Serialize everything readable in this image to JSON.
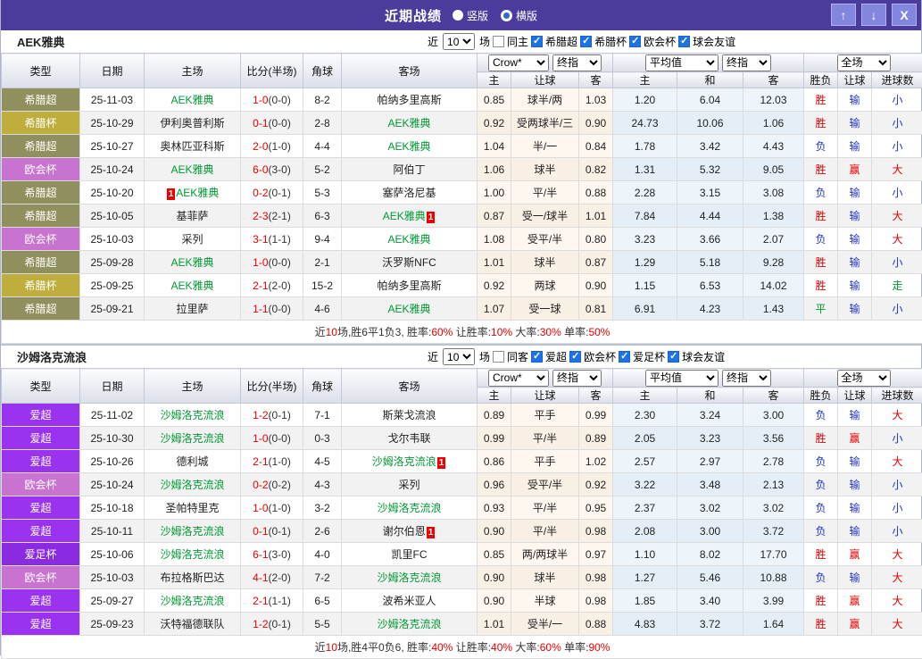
{
  "titlebar": {
    "title": "近期战绩",
    "radios": [
      {
        "label": "竖版",
        "selected": true
      },
      {
        "label": "横版",
        "selected": false
      }
    ],
    "buttons": {
      "up": "↑",
      "down": "↓",
      "close": "X"
    }
  },
  "filter_labels": {
    "near": "近",
    "matches_value": "10",
    "unit": "场"
  },
  "table_header": {
    "type": "类型",
    "date": "日期",
    "home": "主场",
    "score": "比分(半场)",
    "corner": "角球",
    "away": "客场",
    "group1_select1": "Crow*",
    "group1_select2": "终指",
    "group2_select1": "平均值",
    "group2_select2": "终指",
    "group3_select": "全场",
    "sub_odds_home": "主",
    "sub_handicap": "让球",
    "sub_odds_away": "客",
    "sub_avg_home": "主",
    "sub_avg_draw": "和",
    "sub_avg_away": "客",
    "sub_winloss": "胜负",
    "sub_res_handicap": "让球",
    "sub_goals": "进球数"
  },
  "type_colors": {
    "希腊超": "#90905e",
    "希腊杯": "#bfae3e",
    "欧会杯": "#c973d0",
    "爱超": "#9933f0",
    "爱足杯": "#8a2be2"
  },
  "outcome_colors": {
    "win_red": "#e60000",
    "lose_blue": "#2233cc",
    "draw_green": "#009933"
  },
  "sections": [
    {
      "team": "AEK雅典",
      "same_label": "同主",
      "same_checked": false,
      "leagues": [
        "希腊超",
        "希腊杯",
        "欧会杯",
        "球会友谊"
      ],
      "rows": [
        {
          "type": "希腊超",
          "date": "25-11-03",
          "home": {
            "text": "AEK雅典",
            "green": true
          },
          "score": "1-0",
          "half": "(0-0)",
          "corner": "8-2",
          "away": {
            "text": "帕纳多里高斯"
          },
          "odds": [
            "0.85",
            "球半/两",
            "1.03"
          ],
          "avg": [
            "1.20",
            "6.04",
            "12.03"
          ],
          "results": [
            "胜",
            "输",
            "小"
          ]
        },
        {
          "type": "希腊杯",
          "date": "25-10-29",
          "home": {
            "text": "伊利奥普利斯"
          },
          "score": "0-1",
          "half": "(0-0)",
          "corner": "2-8",
          "away": {
            "text": "AEK雅典",
            "green": true
          },
          "odds": [
            "0.92",
            "受两球半/三",
            "0.90"
          ],
          "avg": [
            "24.73",
            "10.06",
            "1.06"
          ],
          "results": [
            "胜",
            "输",
            "小"
          ]
        },
        {
          "type": "希腊超",
          "date": "25-10-27",
          "home": {
            "text": "奥林匹亚科斯"
          },
          "score": "2-0",
          "half": "(1-0)",
          "corner": "4-4",
          "away": {
            "text": "AEK雅典",
            "green": true
          },
          "odds": [
            "1.04",
            "半/一",
            "0.84"
          ],
          "avg": [
            "1.78",
            "3.42",
            "4.43"
          ],
          "results": [
            "负",
            "输",
            "小"
          ]
        },
        {
          "type": "欧会杯",
          "date": "25-10-24",
          "home": {
            "text": "AEK雅典",
            "green": true
          },
          "score": "6-0",
          "half": "(3-0)",
          "corner": "5-2",
          "away": {
            "text": "阿伯丁"
          },
          "odds": [
            "1.06",
            "球半",
            "0.82"
          ],
          "avg": [
            "1.31",
            "5.32",
            "9.05"
          ],
          "results": [
            "胜",
            "赢",
            "大"
          ]
        },
        {
          "type": "希腊超",
          "date": "25-10-20",
          "home": {
            "text": "AEK雅典",
            "green": true,
            "card_before": "1"
          },
          "score": "0-2",
          "half": "(0-1)",
          "corner": "5-3",
          "away": {
            "text": "塞萨洛尼基"
          },
          "odds": [
            "1.00",
            "平/半",
            "0.88"
          ],
          "avg": [
            "2.28",
            "3.15",
            "3.08"
          ],
          "results": [
            "负",
            "输",
            "小"
          ]
        },
        {
          "type": "希腊超",
          "date": "25-10-05",
          "home": {
            "text": "基菲萨"
          },
          "score": "2-3",
          "half": "(2-1)",
          "corner": "6-3",
          "away": {
            "text": "AEK雅典",
            "green": true,
            "card_after": "1"
          },
          "odds": [
            "0.87",
            "受一/球半",
            "1.01"
          ],
          "avg": [
            "7.84",
            "4.44",
            "1.38"
          ],
          "results": [
            "胜",
            "输",
            "大"
          ]
        },
        {
          "type": "欧会杯",
          "date": "25-10-03",
          "home": {
            "text": "采列"
          },
          "score": "3-1",
          "half": "(1-1)",
          "corner": "9-4",
          "away": {
            "text": "AEK雅典",
            "green": true
          },
          "odds": [
            "1.08",
            "受平/半",
            "0.80"
          ],
          "avg": [
            "3.23",
            "3.66",
            "2.07"
          ],
          "results": [
            "负",
            "输",
            "大"
          ]
        },
        {
          "type": "希腊超",
          "date": "25-09-28",
          "home": {
            "text": "AEK雅典",
            "green": true
          },
          "score": "1-0",
          "half": "(0-0)",
          "corner": "2-1",
          "away": {
            "text": "沃罗斯NFC"
          },
          "odds": [
            "1.01",
            "球半",
            "0.87"
          ],
          "avg": [
            "1.29",
            "5.18",
            "9.28"
          ],
          "results": [
            "胜",
            "输",
            "小"
          ]
        },
        {
          "type": "希腊杯",
          "date": "25-09-25",
          "home": {
            "text": "AEK雅典",
            "green": true
          },
          "score": "2-1",
          "half": "(2-0)",
          "corner": "15-2",
          "away": {
            "text": "帕纳多里高斯"
          },
          "odds": [
            "0.92",
            "两球",
            "0.90"
          ],
          "avg": [
            "1.15",
            "6.53",
            "14.02"
          ],
          "results": [
            "胜",
            "输",
            "走"
          ]
        },
        {
          "type": "希腊超",
          "date": "25-09-21",
          "home": {
            "text": "拉里萨"
          },
          "score": "1-1",
          "half": "(0-0)",
          "corner": "4-6",
          "away": {
            "text": "AEK雅典",
            "green": true
          },
          "odds": [
            "1.07",
            "受一球",
            "0.81"
          ],
          "avg": [
            "6.91",
            "4.23",
            "1.43"
          ],
          "results": [
            "平",
            "输",
            "小"
          ]
        }
      ],
      "summary": [
        {
          "t": "近"
        },
        {
          "t": "10",
          "red": true
        },
        {
          "t": "场,胜6平1负3, 胜率:"
        },
        {
          "t": "60%",
          "red": true
        },
        {
          "t": " 让胜率:"
        },
        {
          "t": "10%",
          "red": true
        },
        {
          "t": " 大率:"
        },
        {
          "t": "30%",
          "red": true
        },
        {
          "t": " 单率:"
        },
        {
          "t": "50%",
          "red": true
        }
      ]
    },
    {
      "team": "沙姆洛克流浪",
      "same_label": "同客",
      "same_checked": false,
      "leagues": [
        "爱超",
        "欧会杯",
        "爱足杯",
        "球会友谊"
      ],
      "rows": [
        {
          "type": "爱超",
          "date": "25-11-02",
          "home": {
            "text": "沙姆洛克流浪",
            "green": true
          },
          "score": "1-2",
          "half": "(0-1)",
          "corner": "7-1",
          "away": {
            "text": "斯莱戈流浪"
          },
          "odds": [
            "0.89",
            "平手",
            "0.99"
          ],
          "avg": [
            "2.30",
            "3.24",
            "3.00"
          ],
          "results": [
            "负",
            "输",
            "大"
          ]
        },
        {
          "type": "爱超",
          "date": "25-10-30",
          "home": {
            "text": "沙姆洛克流浪",
            "green": true
          },
          "score": "1-0",
          "half": "(0-0)",
          "corner": "0-3",
          "away": {
            "text": "戈尔韦联"
          },
          "odds": [
            "0.99",
            "平/半",
            "0.89"
          ],
          "avg": [
            "2.05",
            "3.23",
            "3.56"
          ],
          "results": [
            "胜",
            "赢",
            "小"
          ]
        },
        {
          "type": "爱超",
          "date": "25-10-26",
          "home": {
            "text": "德利城"
          },
          "score": "2-1",
          "half": "(1-0)",
          "corner": "4-5",
          "away": {
            "text": "沙姆洛克流浪",
            "green": true,
            "card_after": "1"
          },
          "odds": [
            "0.86",
            "平手",
            "1.02"
          ],
          "avg": [
            "2.57",
            "2.97",
            "2.78"
          ],
          "results": [
            "负",
            "输",
            "大"
          ]
        },
        {
          "type": "欧会杯",
          "date": "25-10-24",
          "home": {
            "text": "沙姆洛克流浪",
            "green": true
          },
          "score": "0-2",
          "half": "(0-2)",
          "corner": "4-3",
          "away": {
            "text": "采列"
          },
          "odds": [
            "0.96",
            "受平/半",
            "0.92"
          ],
          "avg": [
            "3.22",
            "3.48",
            "2.13"
          ],
          "results": [
            "负",
            "输",
            "小"
          ]
        },
        {
          "type": "爱超",
          "date": "25-10-18",
          "home": {
            "text": "圣帕特里克"
          },
          "score": "1-0",
          "half": "(1-0)",
          "corner": "3-2",
          "away": {
            "text": "沙姆洛克流浪",
            "green": true
          },
          "odds": [
            "0.93",
            "平/半",
            "0.95"
          ],
          "avg": [
            "2.37",
            "3.02",
            "3.02"
          ],
          "results": [
            "负",
            "输",
            "小"
          ]
        },
        {
          "type": "爱超",
          "date": "25-10-11",
          "home": {
            "text": "沙姆洛克流浪",
            "green": true
          },
          "score": "0-1",
          "half": "(0-1)",
          "corner": "2-6",
          "away": {
            "text": "谢尔伯恩",
            "card_after": "1"
          },
          "odds": [
            "0.90",
            "平/半",
            "0.98"
          ],
          "avg": [
            "2.08",
            "3.00",
            "3.72"
          ],
          "results": [
            "负",
            "输",
            "小"
          ]
        },
        {
          "type": "爱足杯",
          "date": "25-10-06",
          "home": {
            "text": "沙姆洛克流浪",
            "green": true
          },
          "score": "6-1",
          "half": "(3-0)",
          "corner": "4-0",
          "away": {
            "text": "凯里FC"
          },
          "odds": [
            "0.85",
            "两/两球半",
            "0.97"
          ],
          "avg": [
            "1.10",
            "8.02",
            "17.70"
          ],
          "results": [
            "胜",
            "赢",
            "大"
          ]
        },
        {
          "type": "欧会杯",
          "date": "25-10-03",
          "home": {
            "text": "布拉格斯巴达"
          },
          "score": "4-1",
          "half": "(2-0)",
          "corner": "7-2",
          "away": {
            "text": "沙姆洛克流浪",
            "green": true
          },
          "odds": [
            "0.90",
            "球半",
            "0.98"
          ],
          "avg": [
            "1.27",
            "5.46",
            "10.88"
          ],
          "results": [
            "负",
            "输",
            "大"
          ]
        },
        {
          "type": "爱超",
          "date": "25-09-27",
          "home": {
            "text": "沙姆洛克流浪",
            "green": true
          },
          "score": "2-1",
          "half": "(1-1)",
          "corner": "6-5",
          "away": {
            "text": "波希米亚人"
          },
          "odds": [
            "0.90",
            "半球",
            "0.98"
          ],
          "avg": [
            "1.85",
            "3.40",
            "3.99"
          ],
          "results": [
            "胜",
            "赢",
            "大"
          ]
        },
        {
          "type": "爱超",
          "date": "25-09-23",
          "home": {
            "text": "沃特福德联队"
          },
          "score": "1-2",
          "half": "(0-1)",
          "corner": "5-5",
          "away": {
            "text": "沙姆洛克流浪",
            "green": true
          },
          "odds": [
            "1.01",
            "受半/一",
            "0.88"
          ],
          "avg": [
            "4.83",
            "3.72",
            "1.64"
          ],
          "results": [
            "胜",
            "赢",
            "大"
          ]
        }
      ],
      "summary": [
        {
          "t": "近"
        },
        {
          "t": "10",
          "red": true
        },
        {
          "t": "场,胜4平0负6, 胜率:"
        },
        {
          "t": "40%",
          "red": true
        },
        {
          "t": " 让胜率:"
        },
        {
          "t": "40%",
          "red": true
        },
        {
          "t": " 大率:"
        },
        {
          "t": "60%",
          "red": true
        },
        {
          "t": " 单率:"
        },
        {
          "t": "90%",
          "red": true
        }
      ]
    }
  ]
}
